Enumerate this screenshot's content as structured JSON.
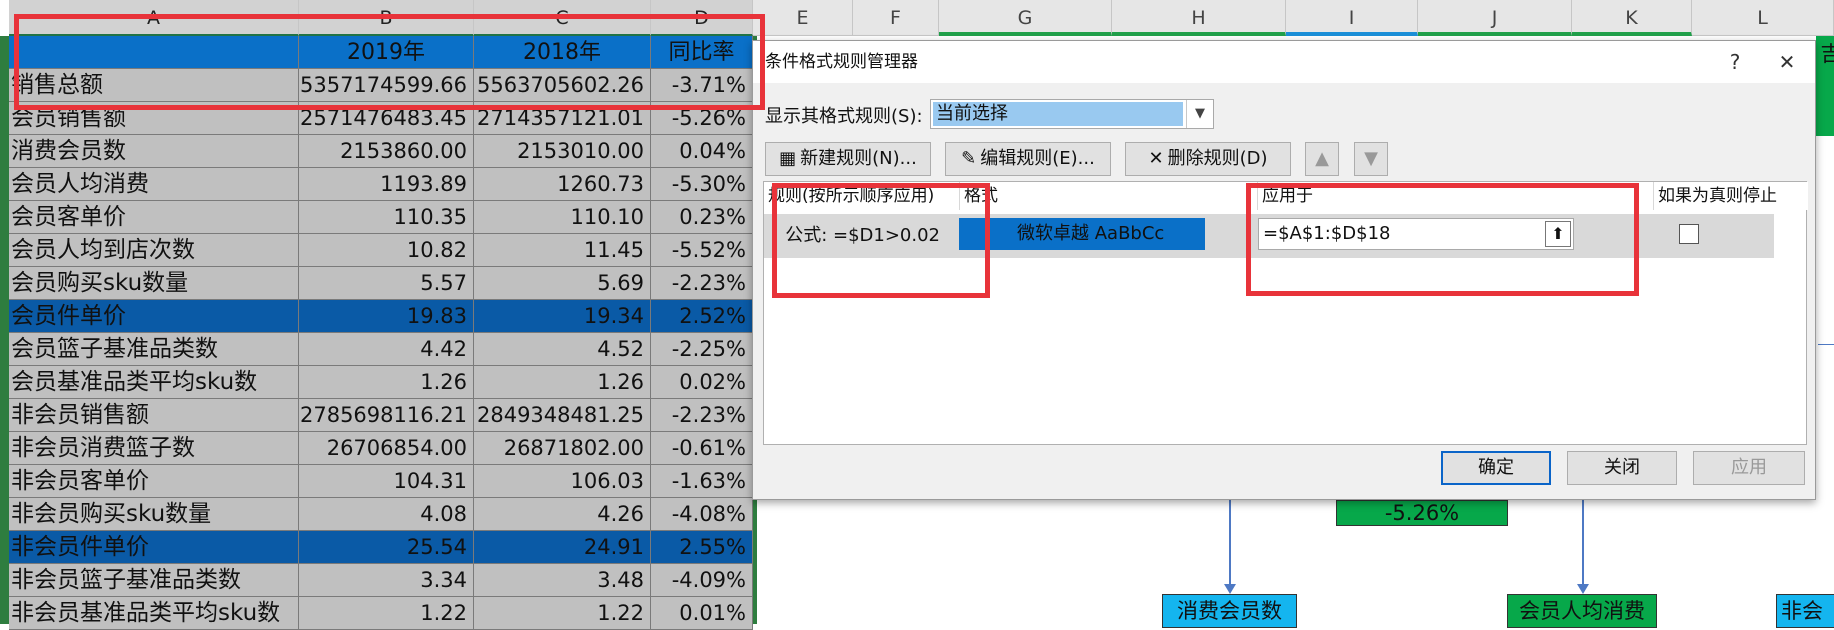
{
  "sheet": {
    "columns": [
      "A",
      "B",
      "C",
      "D",
      "E",
      "F",
      "G",
      "H",
      "I",
      "J",
      "K",
      "L"
    ],
    "header_row": [
      "",
      "2019年",
      "2018年",
      "同比率"
    ],
    "rows": [
      {
        "label": "销售总额",
        "b": "5357174599.66",
        "c": "5563705602.26",
        "d": "-3.71%",
        "hl": false
      },
      {
        "label": "会员销售额",
        "b": "2571476483.45",
        "c": "2714357121.01",
        "d": "-5.26%",
        "hl": false
      },
      {
        "label": "消费会员数",
        "b": "2153860.00",
        "c": "2153010.00",
        "d": "0.04%",
        "hl": false
      },
      {
        "label": "会员人均消费",
        "b": "1193.89",
        "c": "1260.73",
        "d": "-5.30%",
        "hl": false
      },
      {
        "label": "会员客单价",
        "b": "110.35",
        "c": "110.10",
        "d": "0.23%",
        "hl": false
      },
      {
        "label": "会员人均到店次数",
        "b": "10.82",
        "c": "11.45",
        "d": "-5.52%",
        "hl": false
      },
      {
        "label": "会员购买sku数量",
        "b": "5.57",
        "c": "5.69",
        "d": "-2.23%",
        "hl": false
      },
      {
        "label": "会员件单价",
        "b": "19.83",
        "c": "19.34",
        "d": "2.52%",
        "hl": true
      },
      {
        "label": "会员篮子基准品类数",
        "b": "4.42",
        "c": "4.52",
        "d": "-2.25%",
        "hl": false
      },
      {
        "label": "会员基准品类平均sku数",
        "b": "1.26",
        "c": "1.26",
        "d": "0.02%",
        "hl": false
      },
      {
        "label": "非会员销售额",
        "b": "2785698116.21",
        "c": "2849348481.25",
        "d": "-2.23%",
        "hl": false
      },
      {
        "label": "非会员消费篮子数",
        "b": "26706854.00",
        "c": "26871802.00",
        "d": "-0.61%",
        "hl": false
      },
      {
        "label": "非会员客单价",
        "b": "104.31",
        "c": "106.03",
        "d": "-1.63%",
        "hl": false
      },
      {
        "label": "非会员购买sku数量",
        "b": "4.08",
        "c": "4.26",
        "d": "-4.08%",
        "hl": false
      },
      {
        "label": "非会员件单价",
        "b": "25.54",
        "c": "24.91",
        "d": "2.55%",
        "hl": true
      },
      {
        "label": "非会员篮子基准品类数",
        "b": "3.34",
        "c": "3.48",
        "d": "-4.09%",
        "hl": false
      },
      {
        "label": "非会员基准品类平均sku数",
        "b": "1.22",
        "c": "1.22",
        "d": "0.01%",
        "hl": false
      }
    ],
    "diagram": {
      "box_pct": "-5.26%",
      "box_members": "消费会员数",
      "box_avg": "会员人均消费",
      "box_nonmember": "非会",
      "box_top_right": "吉"
    }
  },
  "dialog": {
    "title": "条件格式规则管理器",
    "help": "?",
    "close": "✕",
    "show_rules_label": "显示其格式规则(S):",
    "show_rules_value": "当前选择",
    "new_rule": "新建规则(N)...",
    "edit_rule": "编辑规则(E)...",
    "delete_rule": "删除规则(D)",
    "col_rule": "规则(按所示顺序应用)",
    "col_format": "格式",
    "col_applies": "应用于",
    "col_stop": "如果为真则停止",
    "rule_formula": "公式: =$D1>0.02",
    "rule_preview": "微软卓越  AaBbCc",
    "rule_applies": "=$A$1:$D$18",
    "ok": "确定",
    "close_btn": "关闭",
    "apply": "应用"
  },
  "colors": {
    "highlight_row": "#0a5aa6",
    "header_row": "#0a70c8",
    "annotation_red": "#e8333a"
  }
}
